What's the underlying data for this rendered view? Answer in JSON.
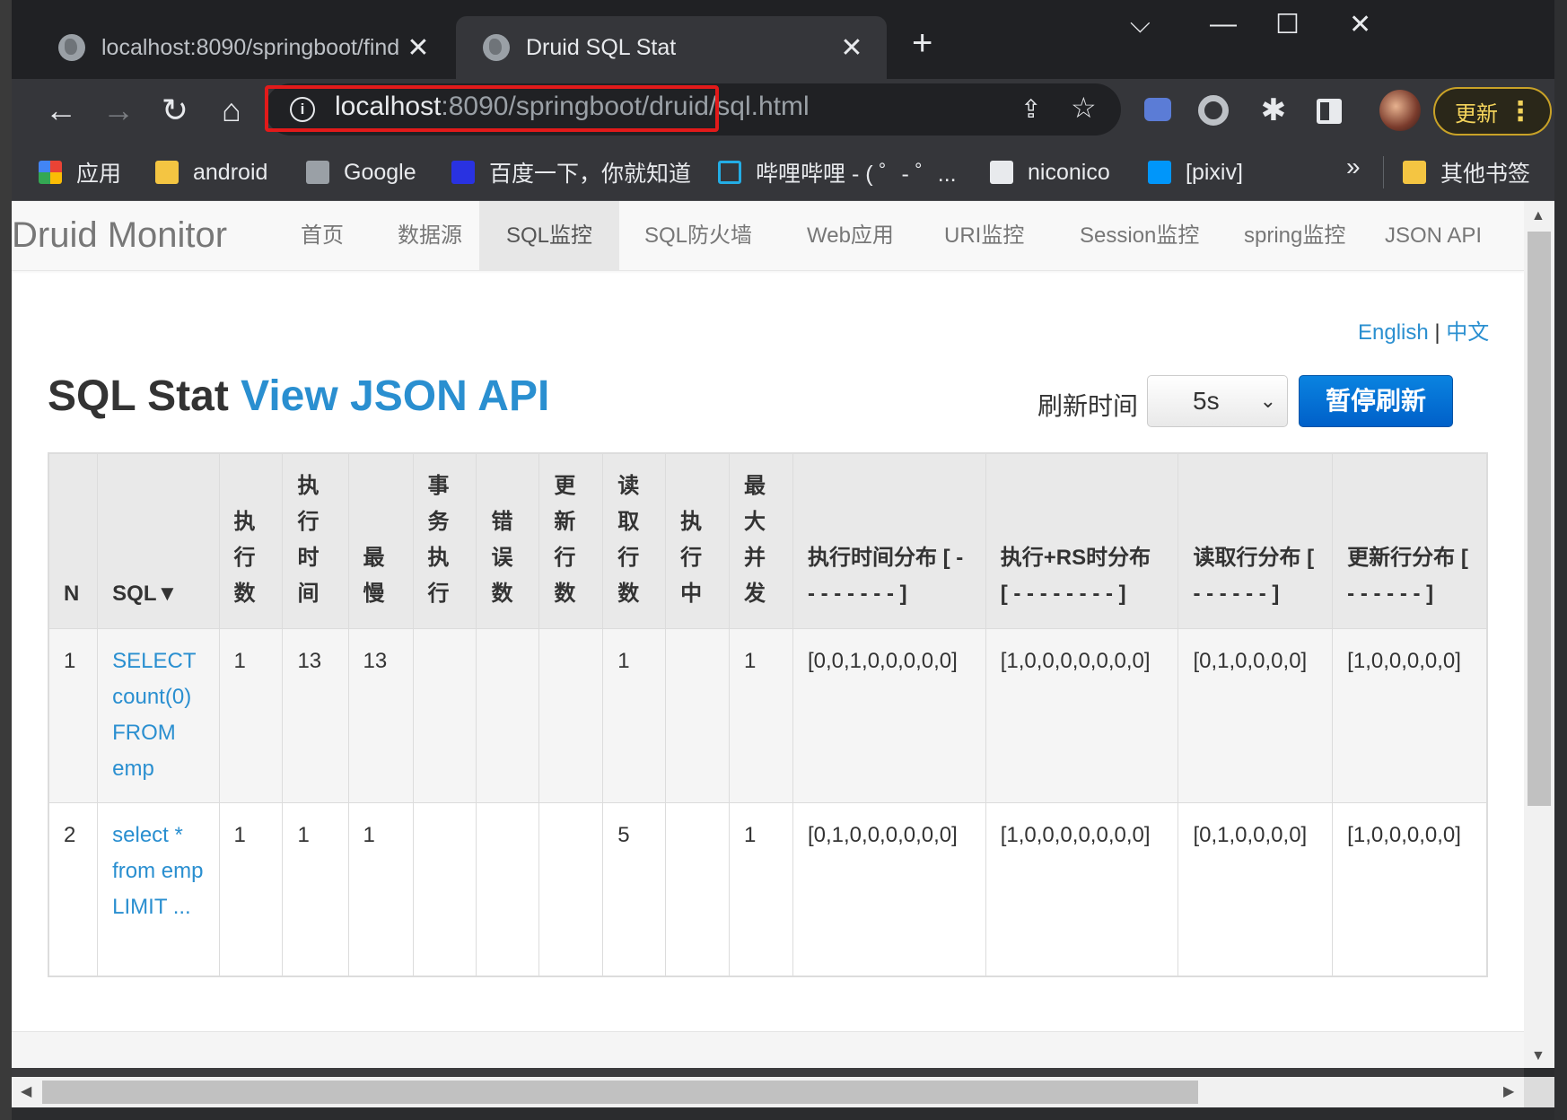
{
  "browser": {
    "tabs": [
      {
        "title": "localhost:8090/springboot/find",
        "active": false
      },
      {
        "title": "Druid SQL Stat",
        "active": true
      }
    ],
    "new_tab": "+",
    "window_controls": {
      "dropdown": "⌵",
      "minimize": "—",
      "maximize": "☐",
      "close": "✕"
    },
    "url": {
      "host": "localhost",
      "rest": ":8090/springboot/druid/sql.html"
    },
    "update_label": "更新",
    "more_label": "⋮",
    "bookmarks": [
      {
        "label": "应用",
        "icon": "apps-icon"
      },
      {
        "label": "android",
        "icon": "folder-icon"
      },
      {
        "label": "Google",
        "icon": "globe-icon"
      },
      {
        "label": "百度一下，你就知道",
        "icon": "baidu-icon"
      },
      {
        "label": "哔哩哔哩 - ( ゜- ゜...",
        "icon": "bilibili-icon"
      },
      {
        "label": "niconico",
        "icon": "niconico-icon"
      },
      {
        "label": "[pixiv]",
        "icon": "pixiv-icon"
      }
    ],
    "bookmarks_more": "»",
    "other_bookmarks": "其他书签"
  },
  "nav": {
    "brand": "Druid Monitor",
    "links": [
      "首页",
      "数据源",
      "SQL监控",
      "SQL防火墙",
      "Web应用",
      "URI监控",
      "Session监控",
      "spring监控",
      "JSON API"
    ],
    "active": "SQL监控"
  },
  "lang": {
    "english": "English",
    "sep": "|",
    "chinese": "中文"
  },
  "heading": {
    "title": "SQL Stat",
    "json_link": "View JSON API"
  },
  "refresh": {
    "label": "刷新时间",
    "selected": "5s",
    "pause_button": "暂停刷新"
  },
  "table": {
    "headers": [
      "N",
      "SQL▼",
      "执行数",
      "执行时间",
      "最慢",
      "事务执行",
      "错误数",
      "更新行数",
      "读取行数",
      "执行中",
      "最大并发",
      "执行时间分布 [ - - - - - - - - ]",
      "执行+RS时分布 [ - - - - - - - - ]",
      "读取行分布 [ - - - - - - ]",
      "更新行分布 [ - - - - - - ]"
    ],
    "rows": [
      {
        "n": "1",
        "sql": "SELECT count(0) FROM emp",
        "exec_count": "1",
        "exec_time": "13",
        "slowest": "13",
        "txn": "",
        "errors": "",
        "updated": "",
        "read": "1",
        "running": "",
        "max_concurrent": "1",
        "exec_hist": "[0,0,1,0,0,0,0,0]",
        "exec_rs_hist": "[1,0,0,0,0,0,0,0]",
        "read_hist": "[0,1,0,0,0,0]",
        "update_hist": "[1,0,0,0,0,0]"
      },
      {
        "n": "2",
        "sql": "select * from emp LIMIT ...",
        "exec_count": "1",
        "exec_time": "1",
        "slowest": "1",
        "txn": "",
        "errors": "",
        "updated": "",
        "read": "5",
        "running": "",
        "max_concurrent": "1",
        "exec_hist": "[0,1,0,0,0,0,0,0]",
        "exec_rs_hist": "[1,0,0,0,0,0,0,0]",
        "read_hist": "[0,1,0,0,0,0]",
        "update_hist": "[1,0,0,0,0,0]"
      }
    ]
  }
}
